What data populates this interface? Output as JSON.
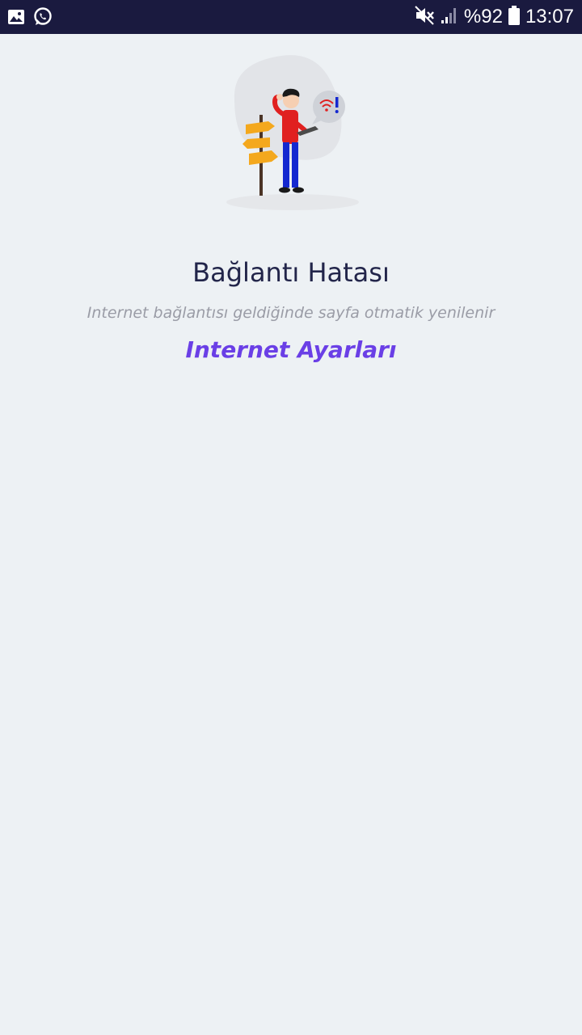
{
  "status_bar": {
    "battery_percent": "%92",
    "time": "13:07",
    "icons": [
      "gallery-icon",
      "whatsapp-icon",
      "mute-icon",
      "signal-icon",
      "battery-icon"
    ]
  },
  "error": {
    "title": "Bağlantı Hatası",
    "subtitle": "Internet bağlantısı geldiğinde sayfa otmatik yenilenir",
    "settings_link": "Internet Ayarları"
  },
  "colors": {
    "status_bar_bg": "#1a1a3f",
    "page_bg": "#edf1f4",
    "title": "#22254a",
    "subtitle": "#9a9ca6",
    "link": "#6a3fe6",
    "shirt": "#e02020",
    "pants": "#1428d0",
    "signpost": "#f4a81d"
  }
}
